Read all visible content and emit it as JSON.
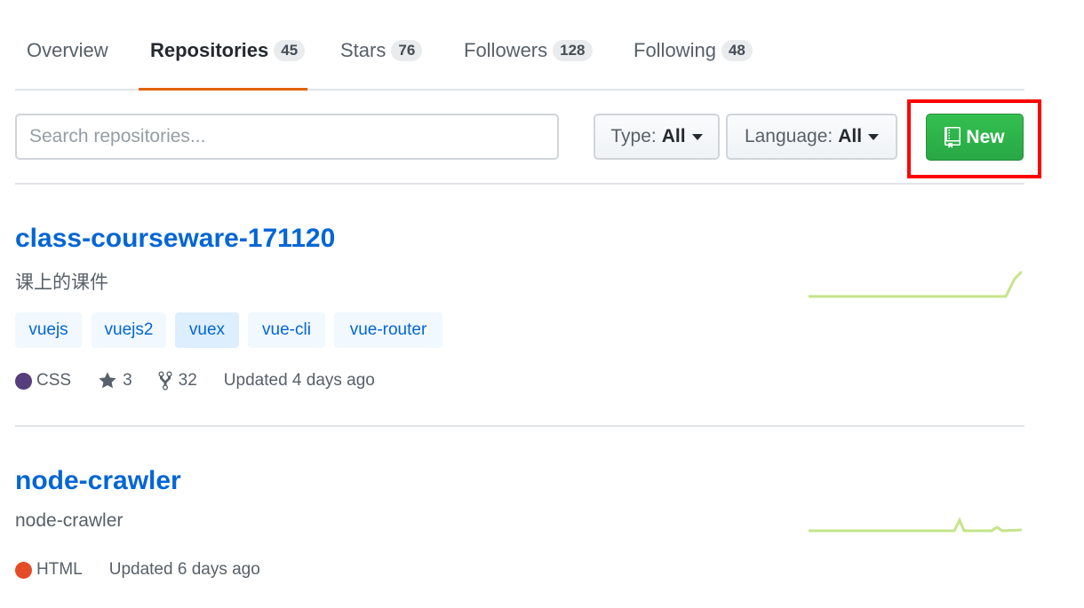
{
  "tabs": [
    {
      "label": "Overview",
      "count": ""
    },
    {
      "label": "Repositories",
      "count": "45"
    },
    {
      "label": "Stars",
      "count": "76"
    },
    {
      "label": "Followers",
      "count": "128"
    },
    {
      "label": "Following",
      "count": "48"
    }
  ],
  "filters": {
    "search_placeholder": "Search repositories...",
    "type_label": "Type:",
    "type_value": "All",
    "language_label": "Language:",
    "language_value": "All",
    "new_label": "New"
  },
  "colors": {
    "accent_underline": "#e36209",
    "new_button": "#28a745",
    "highlight_box": "#ff0000",
    "link": "#0366d6",
    "css_lang": "#563d7c",
    "html_lang": "#e34c26",
    "sparkline": "#c6e48b"
  },
  "repos": [
    {
      "name": "class-courseware-171120",
      "description": "课上的课件",
      "topics": [
        "vuejs",
        "vuejs2",
        "vuex",
        "vue-cli",
        "vue-router"
      ],
      "language": "CSS",
      "language_color": "#563d7c",
      "stars": "3",
      "forks": "32",
      "updated": "Updated 4 days ago"
    },
    {
      "name": "node-crawler",
      "description": "node-crawler",
      "topics": [],
      "language": "HTML",
      "language_color": "#e34c26",
      "stars": "",
      "forks": "",
      "updated": "Updated 6 days ago"
    }
  ]
}
